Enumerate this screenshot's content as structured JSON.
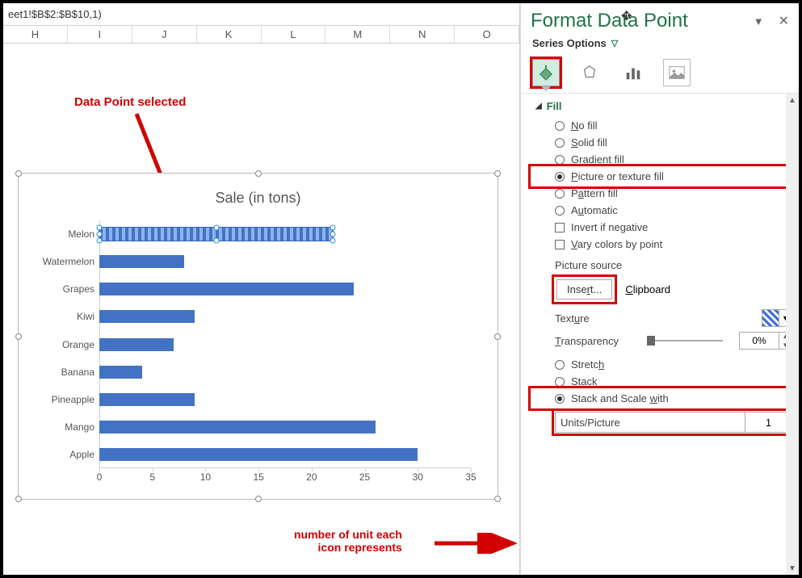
{
  "formula_fragment": "eet1!$B$2:$B$10,1)",
  "columns": [
    "H",
    "I",
    "J",
    "K",
    "L",
    "M",
    "N",
    "O"
  ],
  "annot1": "Data Point selected",
  "annot2_line1": "number of unit each",
  "annot2_line2": "icon represents",
  "chart": {
    "title": "Sale (in tons)",
    "x_ticks": [
      "0",
      "5",
      "10",
      "15",
      "20",
      "25",
      "30",
      "35"
    ]
  },
  "chart_data": {
    "type": "bar",
    "orientation": "horizontal",
    "title": "Sale (in tons)",
    "xlabel": "",
    "ylabel": "",
    "xlim": [
      0,
      35
    ],
    "categories": [
      "Melon",
      "Watermelon",
      "Grapes",
      "Kiwi",
      "Orange",
      "Banana",
      "Pineapple",
      "Mango",
      "Apple"
    ],
    "values": [
      22,
      8,
      24,
      9,
      7,
      4,
      9,
      26,
      30
    ],
    "selected_category": "Melon"
  },
  "pane": {
    "title": "Format Data Point",
    "series_options": "Series Options",
    "fill": "Fill",
    "no_fill": "No fill",
    "solid_fill": "Solid fill",
    "gradient_fill": "Gradient fill",
    "picture_fill": "Picture or texture fill",
    "pattern_fill": "Pattern fill",
    "automatic": "Automatic",
    "invert": "Invert if negative",
    "vary": "Vary colors by point",
    "picture_source": "Picture source",
    "insert": "Insert...",
    "clipboard": "Clipboard",
    "texture": "Texture",
    "transparency": "Transparency",
    "transparency_val": "0%",
    "stretch": "Stretch",
    "stack": "Stack",
    "stack_scale": "Stack and Scale with",
    "units_picture": "Units/Picture",
    "units_val": "1"
  }
}
